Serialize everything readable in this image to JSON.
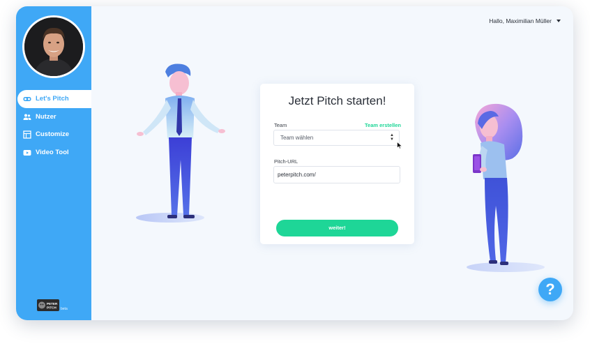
{
  "sidebar": {
    "items": [
      {
        "label": "Let's Pitch",
        "icon": "vr-glasses-icon",
        "active": true
      },
      {
        "label": "Nutzer",
        "icon": "users-icon",
        "active": false
      },
      {
        "label": "Customize",
        "icon": "layout-icon",
        "active": false
      },
      {
        "label": "Video Tool",
        "icon": "video-icon",
        "active": false
      }
    ],
    "brand": {
      "logo_text": "PETER PITCH",
      "tag": "beta"
    }
  },
  "header": {
    "user_greeting": "Hallo, Maximilian Müller"
  },
  "card": {
    "title": "Jetzt Pitch starten!",
    "team_label": "Team",
    "team_create_link": "Team erstellen",
    "team_select_value": "Team wählen",
    "url_label": "Pitch-URL",
    "url_value": "peterpitch.com/",
    "submit_label": "weiter!"
  },
  "help": {
    "label": "?"
  },
  "colors": {
    "primary": "#3fa8f6",
    "accent": "#1ed697",
    "background": "#f4f8fd",
    "text": "#2a2f38"
  }
}
